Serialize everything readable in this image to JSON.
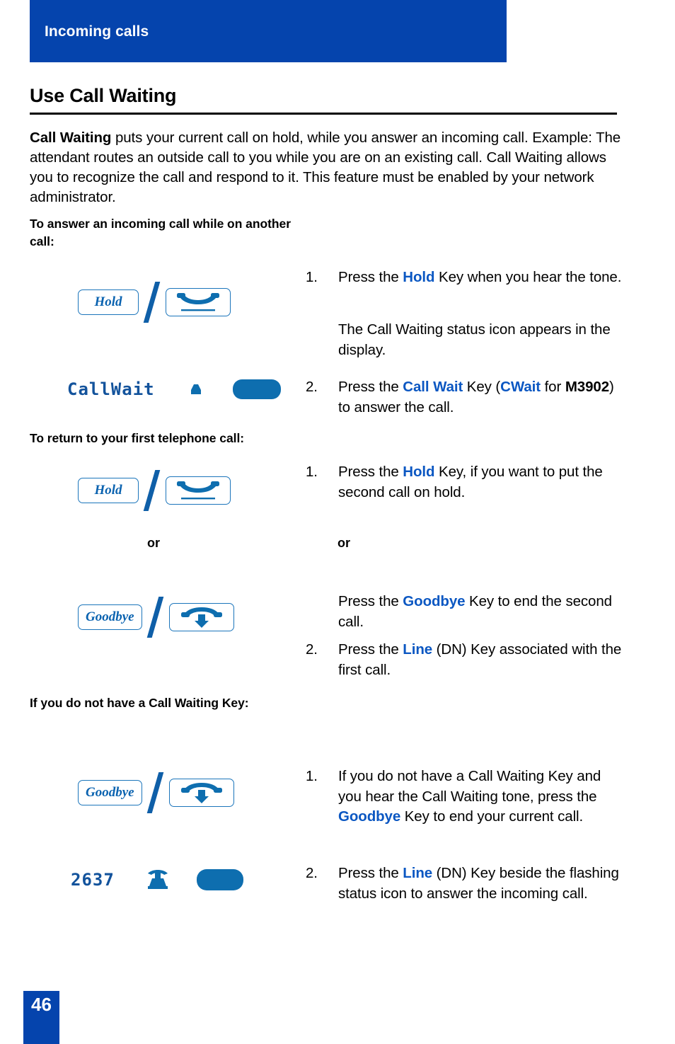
{
  "colors": {
    "brand_blue": "#0544AD",
    "accent_blue": "#0B57C2",
    "icon_blue": "#0E6EAF",
    "key_border_blue": "#1B75BB",
    "lcd_blue": "#13539C"
  },
  "header": {
    "title": "Incoming calls"
  },
  "page_title": "Use Call Waiting",
  "intro": {
    "lead": "Call Waiting",
    "body": " puts your current call on hold, while you answer an incoming call. Example: The attendant routes an outside call to you while you are on an existing call. Call Waiting allows you to recognize the call and respond to it. This feature must be enabled by your network administrator."
  },
  "subheads": {
    "answer_while_on_another": "To answer an incoming call while on another call:",
    "return_to_first": "To return to your first telephone call:",
    "no_call_waiting_key": "If you do not have a Call Waiting Key:"
  },
  "or_separator": "or",
  "keys": {
    "hold_label": "Hold",
    "goodbye_label": "Goodbye"
  },
  "displays": {
    "callwait_text": "CallWait",
    "dn_text": "2637"
  },
  "steps": {
    "s1": {
      "num": "1.",
      "parts": [
        {
          "t": "Press the ",
          "s": "plain"
        },
        {
          "t": "Hold",
          "s": "blue"
        },
        {
          "t": " Key when you hear the tone.",
          "s": "plain"
        }
      ]
    },
    "s1b": {
      "num": "",
      "parts": [
        {
          "t": "The Call Waiting status icon appears in the display.",
          "s": "plain"
        }
      ]
    },
    "s2": {
      "num": "2.",
      "parts": [
        {
          "t": "Press the ",
          "s": "plain"
        },
        {
          "t": "Call Wait",
          "s": "blue"
        },
        {
          "t": " Key (",
          "s": "plain"
        },
        {
          "t": "CWait",
          "s": "blue"
        },
        {
          "t": " for ",
          "s": "plain"
        },
        {
          "t": "M3902",
          "s": "black-bold"
        },
        {
          "t": ") to answer the call.",
          "s": "plain"
        }
      ]
    },
    "s3": {
      "num": "1.",
      "parts": [
        {
          "t": "Press the ",
          "s": "plain"
        },
        {
          "t": "Hold",
          "s": "blue"
        },
        {
          "t": " Key, if you want to put the second call on hold.",
          "s": "plain"
        }
      ]
    },
    "s4": {
      "num": "",
      "parts": [
        {
          "t": "Press the ",
          "s": "plain"
        },
        {
          "t": "Goodbye",
          "s": "blue"
        },
        {
          "t": " Key to end the second call.",
          "s": "plain"
        }
      ]
    },
    "s5": {
      "num": "2.",
      "parts": [
        {
          "t": "Press the ",
          "s": "plain"
        },
        {
          "t": "Line",
          "s": "blue"
        },
        {
          "t": " (DN) Key associated with the first call.",
          "s": "plain"
        }
      ]
    },
    "s6": {
      "num": "1.",
      "parts": [
        {
          "t": "If you do not have a Call Waiting Key and you hear the Call Waiting tone, press the ",
          "s": "plain"
        },
        {
          "t": "Goodbye",
          "s": "blue"
        },
        {
          "t": " Key to end your current call.",
          "s": "plain"
        }
      ]
    },
    "s7": {
      "num": "2.",
      "parts": [
        {
          "t": "Press the ",
          "s": "plain"
        },
        {
          "t": "Line",
          "s": "blue"
        },
        {
          "t": " (DN) Key beside the flashing status icon to answer the incoming call.",
          "s": "plain"
        }
      ]
    }
  },
  "footer": {
    "page_number": "46"
  }
}
